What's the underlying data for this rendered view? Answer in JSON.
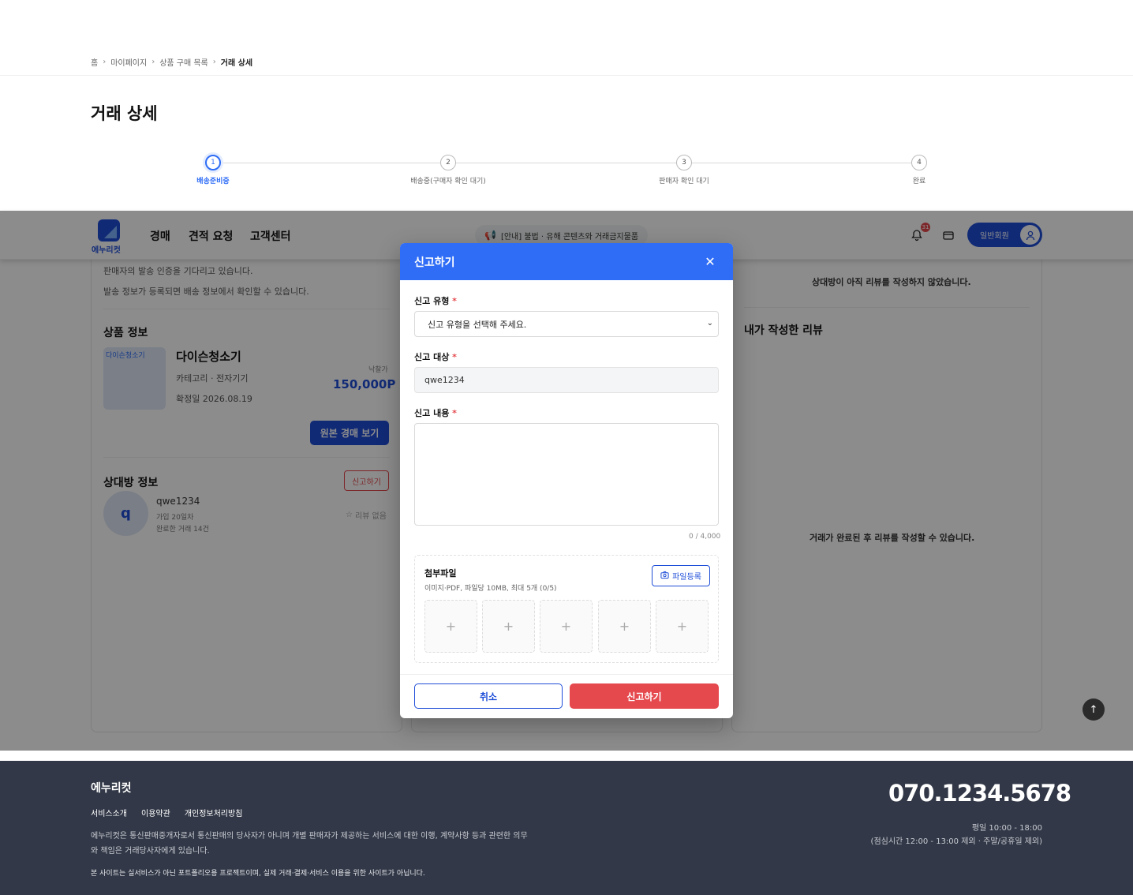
{
  "breadcrumb": [
    "홈",
    "마이페이지",
    "상품 구매 목록",
    "거래 상세"
  ],
  "page_title": "거래 상세",
  "steps": [
    {
      "num": "1",
      "label": "배송준비중",
      "active": true
    },
    {
      "num": "2",
      "label": "배송중(구매자 확인 대기)",
      "active": false
    },
    {
      "num": "3",
      "label": "판매자 확인 대기",
      "active": false
    },
    {
      "num": "4",
      "label": "완료",
      "active": false
    }
  ],
  "header": {
    "logo_text": "에누리컷",
    "nav": [
      "경매",
      "견적 요청",
      "고객센터"
    ],
    "notice": "[안내] 불법 · 유해 콘텐츠와 거래금지물품",
    "notification_count": "31",
    "member_label": "일반회원"
  },
  "left_card": {
    "shipping_msg_1": "판매자의 발송 인증을 기다리고 있습니다.",
    "shipping_msg_2": "발송 정보가 등록되면 배송 정보에서 확인할 수 있습니다.",
    "product_section_title": "상품 정보",
    "product_image_alt": "다이슨청소기",
    "product_name": "다이슨청소기",
    "category": "카테고리 · 전자기기",
    "confirm_date": "확정일 2026.08.19",
    "win_label": "낙찰가",
    "win_price": "150,000P",
    "view_auction_button": "원본 경매 보기",
    "partner_section_title": "상대방 정보",
    "report_button": "신고하기",
    "partner_initial": "q",
    "partner_id": "qwe1234",
    "partner_joined": "가입 20일차",
    "partner_trades": "완료한 거래 14건",
    "review_none": "리뷰 없음"
  },
  "right_card": {
    "no_review_msg": "상대방이 아직 리뷰를 작성하지 않았습니다.",
    "my_review_title": "내가 작성한 리뷰",
    "after_complete_msg": "거래가 완료된 후 리뷰를 작성할 수 있습니다."
  },
  "modal": {
    "title": "신고하기",
    "type_label": "신고 유형",
    "type_placeholder": "신고 유형을 선택해 주세요.",
    "target_label": "신고 대상",
    "target_value": "qwe1234",
    "content_label": "신고 내용",
    "content_value": "",
    "counter": "0 / 4,000",
    "attach_title": "첨부파일",
    "attach_desc": "이미지·PDF, 파일당 10MB, 최대 5개 (0/5)",
    "file_button": "파일등록",
    "slot_plus": "+",
    "cancel_button": "취소",
    "submit_button": "신고하기"
  },
  "footer": {
    "logo": "에누리컷",
    "links": [
      "서비스소개",
      "이용약관",
      "개인정보처리방침"
    ],
    "desc": "에누리컷은 통신판매중개자로서 통신판매의 당사자가 아니며 개별 판매자가 제공하는 서비스에 대한 이행, 계약사항 등과 관련한 의무와 책임은 거래당사자에게 있습니다.",
    "note": "본 사이트는 실서비스가 아닌 포트폴리오용 프로젝트이며, 실제 거래·결제·서비스 이용을 위한 사이트가 아닙니다.",
    "phone": "070.1234.5678",
    "hours_1": "평일 10:00 - 18:00",
    "hours_2": "(점심시간 12:00 - 13:00 제외 · 주말/공휴일 제외)"
  },
  "colors": {
    "primary": "#1f4ed8",
    "accent": "#2f6df6",
    "danger": "#e5484d",
    "footer_bg": "#323847"
  }
}
